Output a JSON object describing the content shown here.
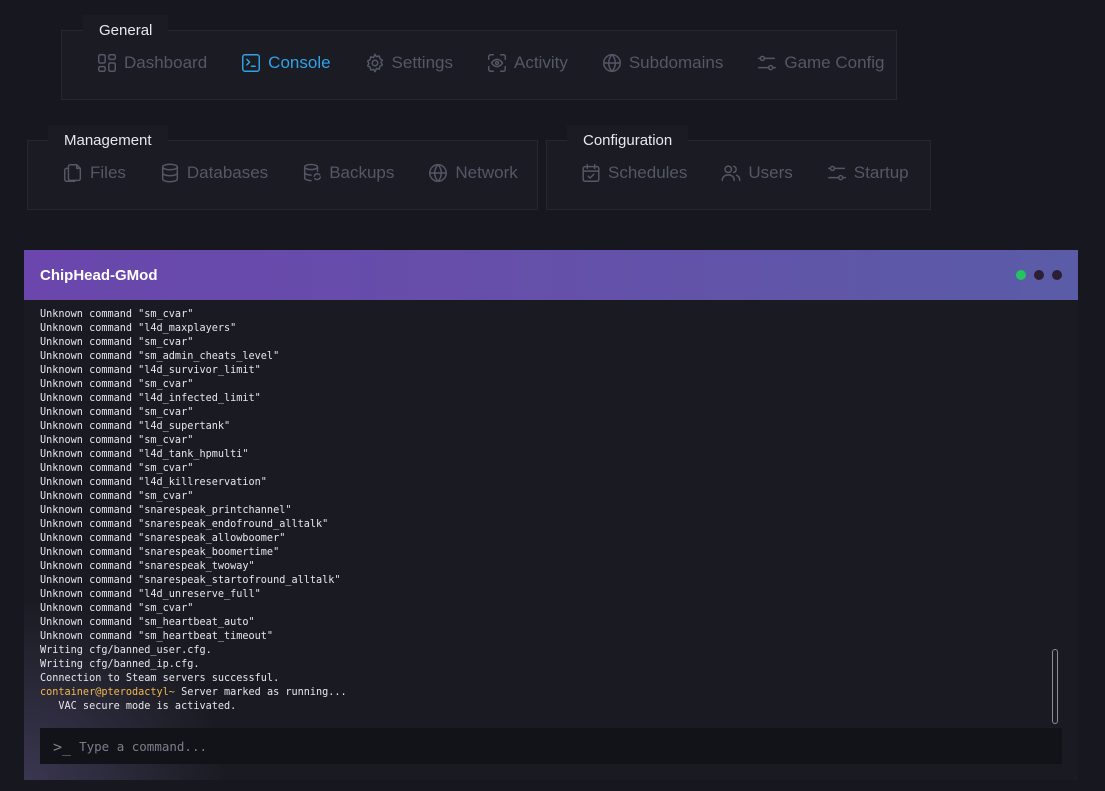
{
  "nav": {
    "general": {
      "title": "General",
      "tabs": [
        {
          "label": "Dashboard",
          "icon": "dashboard-icon"
        },
        {
          "label": "Console",
          "icon": "terminal-icon",
          "active": true
        },
        {
          "label": "Settings",
          "icon": "gear-icon"
        },
        {
          "label": "Activity",
          "icon": "eye-scan-icon"
        },
        {
          "label": "Subdomains",
          "icon": "globe-icon"
        },
        {
          "label": "Game Config",
          "icon": "sliders-icon"
        }
      ]
    },
    "management": {
      "title": "Management",
      "tabs": [
        {
          "label": "Files",
          "icon": "files-icon"
        },
        {
          "label": "Databases",
          "icon": "database-icon"
        },
        {
          "label": "Backups",
          "icon": "backup-icon"
        },
        {
          "label": "Network",
          "icon": "globe-icon"
        }
      ]
    },
    "configuration": {
      "title": "Configuration",
      "tabs": [
        {
          "label": "Schedules",
          "icon": "calendar-icon"
        },
        {
          "label": "Users",
          "icon": "users-icon"
        },
        {
          "label": "Startup",
          "icon": "sliders-icon"
        }
      ]
    }
  },
  "colors": {
    "accent": "#30a2e8",
    "inactive": "#545766",
    "header_start": "#6a46ad",
    "header_end": "#5a5ca8",
    "prompt_user": "#f2b94a",
    "dot_green": "#22c55e",
    "dot_dark": "#2b1f33"
  },
  "console": {
    "server_name": "ChipHead-GMod",
    "log_lines": [
      "Unknown command \"sm_cvar\"",
      "Unknown command \"l4d_maxplayers\"",
      "Unknown command \"sm_cvar\"",
      "Unknown command \"sm_admin_cheats_level\"",
      "Unknown command \"l4d_survivor_limit\"",
      "Unknown command \"sm_cvar\"",
      "Unknown command \"l4d_infected_limit\"",
      "Unknown command \"sm_cvar\"",
      "Unknown command \"l4d_supertank\"",
      "Unknown command \"sm_cvar\"",
      "Unknown command \"l4d_tank_hpmulti\"",
      "Unknown command \"sm_cvar\"",
      "Unknown command \"l4d_killreservation\"",
      "Unknown command \"sm_cvar\"",
      "Unknown command \"snarespeak_printchannel\"",
      "Unknown command \"snarespeak_endofround_alltalk\"",
      "Unknown command \"snarespeak_allowboomer\"",
      "Unknown command \"snarespeak_boomertime\"",
      "Unknown command \"snarespeak_twoway\"",
      "Unknown command \"snarespeak_startofround_alltalk\"",
      "Unknown command \"l4d_unreserve_full\"",
      "Unknown command \"sm_cvar\"",
      "Unknown command \"sm_heartbeat_auto\"",
      "Unknown command \"sm_heartbeat_timeout\"",
      "Writing cfg/banned_user.cfg.",
      "Writing cfg/banned_ip.cfg.",
      "Connection to Steam servers successful."
    ],
    "prompt": {
      "user": "container@pterodactyl~",
      "message": " Server marked as running..."
    },
    "last_line": "   VAC secure mode is activated.",
    "input_icon": ">_",
    "input_placeholder": "Type a command..."
  }
}
